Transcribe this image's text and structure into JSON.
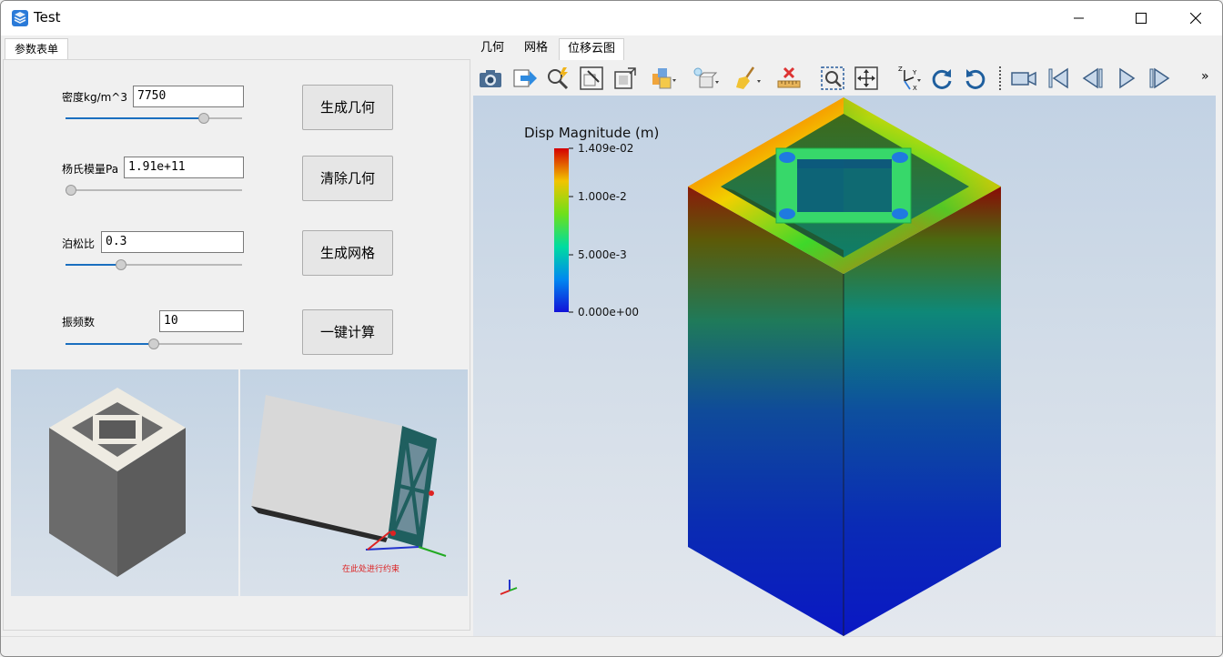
{
  "window": {
    "title": "Test"
  },
  "left": {
    "tab": "参数表单",
    "params": [
      {
        "label": "密度kg/m^3",
        "value": "7750",
        "slider": 0.8
      },
      {
        "label": "杨氏模量Pa",
        "value": "1.91e+11",
        "slider": 0.0
      },
      {
        "label": "泊松比",
        "value": "0.3",
        "slider": 0.3
      },
      {
        "label": "振频数",
        "value": "10",
        "slider": 0.5
      }
    ],
    "buttons": [
      "生成几何",
      "清除几何",
      "生成网格",
      "一键计算"
    ],
    "preview_caption": "在此处进行约束"
  },
  "right": {
    "tabs": [
      "几何",
      "网格",
      "位移云图"
    ],
    "active_tab": "位移云图",
    "toolbar_more": "»",
    "legend": {
      "title": "Disp Magnitude (m)",
      "labels": [
        "1.409e-02",
        "1.000e-2",
        "5.000e-3",
        "0.000e+00"
      ]
    },
    "axes": {
      "x": "X",
      "y": "Y",
      "z": "Z"
    }
  },
  "colors": {
    "accent": "#1a6fbf",
    "mesh_teal": "#1f5f5f"
  },
  "icons": [
    "screenshot-icon",
    "export-icon",
    "zoom-to-selection-icon",
    "reset-camera-icon",
    "fit-icon",
    "color-icon",
    "lighting-icon",
    "clear-icon",
    "ruler-icon",
    "rubber-band-zoom-icon",
    "pan-icon",
    "axes-orientation-icon",
    "rotate-cw-icon",
    "rotate-ccw-icon",
    "camera-icon",
    "first-frame-icon",
    "prev-frame-icon",
    "play-icon",
    "next-frame-icon"
  ]
}
